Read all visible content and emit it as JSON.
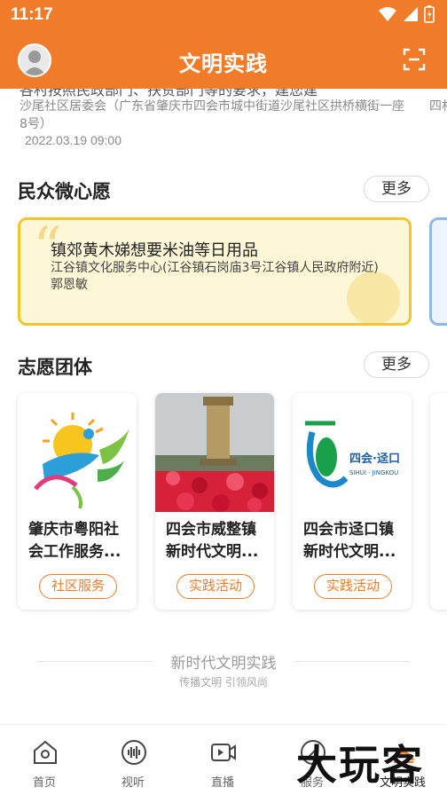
{
  "status_bar": {
    "time": "11:17"
  },
  "app_bar": {
    "title": "文明实践"
  },
  "prev_item": {
    "title_cut": "各村按照民政部门、扶贫部门等的要求，建您建",
    "address": "沙尾社区居委会（广东省肇庆市四会市城中街道沙尾社区拱桥横街一座8号）",
    "date": "2022.03.19 09:00",
    "next_peek": "四村"
  },
  "wishes": {
    "title": "民众微心愿",
    "more": "更多",
    "item": {
      "title": "镇郊黄木娣想要米油等日用品",
      "address": "江谷镇文化服务中心(江谷镇石岗庙3号江谷镇人民政府附近) 郭恩敏"
    }
  },
  "teams": {
    "title": "志愿团体",
    "more": "更多",
    "items": [
      {
        "name": "肇庆市粤阳社会工作服务...",
        "tag": "社区服务",
        "logo_text": ""
      },
      {
        "name": "四会市威整镇新时代文明...",
        "tag": "实践活动",
        "logo_text": ""
      },
      {
        "name": "四会市迳口镇新时代文明...",
        "tag": "实践活动",
        "logo_text": "四会·迳口",
        "logo_sub": "SIHUI · JINGKOU"
      }
    ]
  },
  "footer": {
    "title": "新时代文明实践",
    "subtitle": "传播文明 引领风尚"
  },
  "tabs": [
    {
      "label": "首页",
      "icon": "home-icon"
    },
    {
      "label": "视听",
      "icon": "audio-icon"
    },
    {
      "label": "直播",
      "icon": "live-icon"
    },
    {
      "label": "服务",
      "icon": "service-icon"
    },
    {
      "label": "文明实践",
      "icon": "practice-icon"
    }
  ],
  "watermark": "大玩客",
  "colors": {
    "primary": "#f07c2a",
    "wish_border": "#f3c52f",
    "wish_bg": "#fdf6d7"
  }
}
